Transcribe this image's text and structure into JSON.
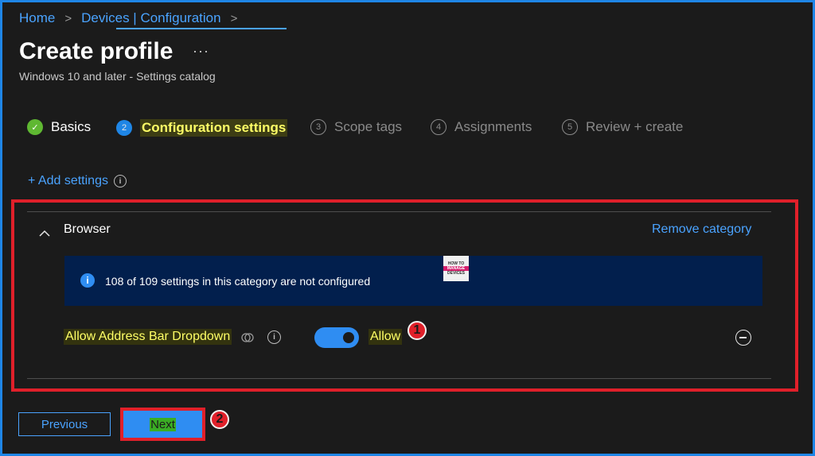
{
  "breadcrumb": {
    "items": [
      "Home",
      "Devices | Configuration"
    ],
    "separator": ">"
  },
  "header": {
    "title": "Create profile",
    "more": "···",
    "subtitle": "Windows 10 and later - Settings catalog"
  },
  "wizard": {
    "steps": [
      {
        "number": "✓",
        "label": "Basics",
        "state": "completed"
      },
      {
        "number": "2",
        "label": "Configuration settings",
        "state": "active"
      },
      {
        "number": "3",
        "label": "Scope tags",
        "state": "pending"
      },
      {
        "number": "4",
        "label": "Assignments",
        "state": "pending"
      },
      {
        "number": "5",
        "label": "Review + create",
        "state": "pending"
      }
    ]
  },
  "add_settings": {
    "label": "+ Add settings",
    "info": "i"
  },
  "category": {
    "name": "Browser",
    "remove_label": "Remove category",
    "info_text": "108 of 109 settings in this category are not configured",
    "logo": {
      "line1": "HOW TO",
      "line2": "MANAGE",
      "line3": "DEVICES"
    }
  },
  "setting": {
    "name": "Allow Address Bar Dropdown",
    "value_label": "Allow",
    "toggle_on": true
  },
  "annotations": {
    "badge1": "1",
    "badge2": "2"
  },
  "footer": {
    "previous_label": "Previous",
    "next_label": "Next"
  },
  "colors": {
    "accent": "#1f86e6",
    "link": "#4aa3ff",
    "highlight_box": "#e0202a",
    "success": "#5fb832",
    "info_bar": "#021f4d"
  }
}
